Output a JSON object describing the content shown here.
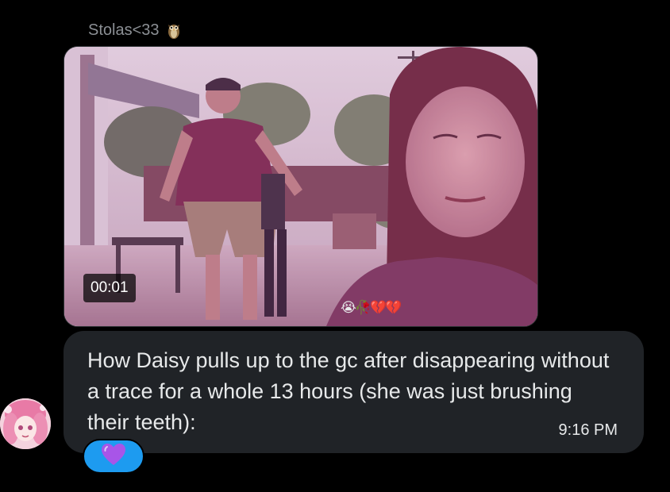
{
  "sender": {
    "name": "Stolas<33",
    "badge_icon": "owl-emoji-icon"
  },
  "video": {
    "duration": "00:01",
    "stickers": "😭🥀💔💔"
  },
  "message": {
    "text": "How Daisy pulls up to the gc after disappearing without a trace for a whole 13 hours (she was just brushing their teeth):",
    "time": "9:16 PM"
  },
  "reaction": {
    "emoji": "💜",
    "icon": "purple-heart-icon"
  },
  "colors": {
    "background": "#000000",
    "bubble": "#202327",
    "reaction_pill": "#1d9bf0",
    "muted_text": "#8b8f94"
  }
}
